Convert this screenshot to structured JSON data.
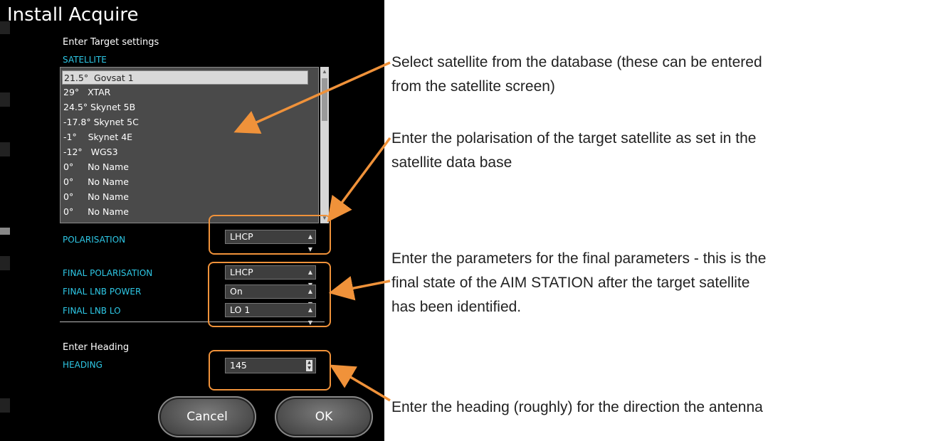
{
  "window": {
    "title": "Install Acquire"
  },
  "target": {
    "heading": "Enter Target settings",
    "satellite_label": "SATELLITE",
    "satellites": [
      "21.5°  Govsat 1",
      "29°   XTAR",
      "24.5° Skynet 5B",
      "-17.8° Skynet 5C",
      "-1°    Skynet 4E",
      "-12°   WGS3",
      "0°     No Name",
      "0°     No Name",
      "0°     No Name",
      "0°     No Name"
    ],
    "polarisation_label": "POLARISATION",
    "polarisation_value": "LHCP"
  },
  "final": {
    "polarisation_label": "FINAL POLARISATION",
    "polarisation_value": "LHCP",
    "lnb_power_label": "FINAL LNB POWER",
    "lnb_power_value": "On",
    "lnb_lo_label": "FINAL LNB LO",
    "lnb_lo_value": "LO 1"
  },
  "heading": {
    "section_title": "Enter Heading",
    "label": "HEADING",
    "value": "145"
  },
  "buttons": {
    "cancel": "Cancel",
    "ok": "OK"
  },
  "annotations": {
    "satellite_line1": "Select satellite from the database (these can be entered",
    "satellite_line2": "from the satellite screen)",
    "polarisation_line1": "Enter the polarisation of the target satellite as set in the",
    "polarisation_line2": "satellite data base",
    "final_line1": "Enter the parameters for the final parameters - this is the",
    "final_line2": "final state of the AIM STATION after the target satellite",
    "final_line3": "has been identified.",
    "heading_line1": "Enter the heading (roughly) for the direction the antenna"
  },
  "colors": {
    "accent_label": "#2ec8e6",
    "callout": "#f0923a",
    "panel_bg": "#000000"
  }
}
